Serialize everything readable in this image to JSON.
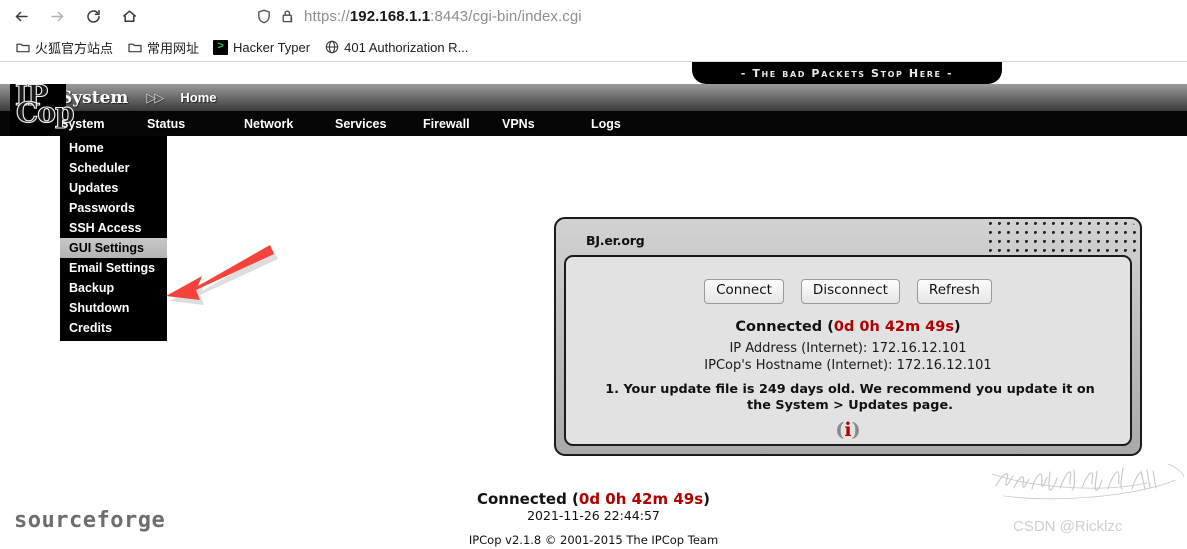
{
  "browser": {
    "back_label": "Back",
    "forward_label": "Forward",
    "reload_label": "Reload",
    "home_label": "Home",
    "shield_icon": "shield-icon",
    "lock_warning_icon": "lock-warning-icon",
    "url_scheme": "https://",
    "url_host": "192.168.1.1",
    "url_rest": ":8443/cgi-bin/index.cgi",
    "url_full": "https://192.168.1.1:8443/cgi-bin/index.cgi",
    "bookmarks": [
      {
        "label": "火狐官方站点",
        "icon": "folder-icon"
      },
      {
        "label": "常用网址",
        "icon": "folder-icon"
      },
      {
        "label": "Hacker Typer",
        "icon": "terminal-icon",
        "glyph": ">"
      },
      {
        "label": "401 Authorization R...",
        "icon": "globe-icon"
      }
    ]
  },
  "banner": {
    "text": "- The bad Packets Stop Here -"
  },
  "logo": {
    "line1": "IP",
    "line2": "Cop",
    "alt": "ipcop-logo"
  },
  "header": {
    "section": "System",
    "separator": "▷▷",
    "breadcrumb": "Home"
  },
  "nav": {
    "items": [
      {
        "label": "System",
        "active": true
      },
      {
        "label": "Status",
        "active": false
      },
      {
        "label": "Network",
        "active": false
      },
      {
        "label": "Services",
        "active": false
      },
      {
        "label": "Firewall",
        "active": false
      },
      {
        "label": "VPNs",
        "active": false
      },
      {
        "label": "Logs",
        "active": false
      }
    ]
  },
  "submenu": {
    "items": [
      {
        "label": "Home",
        "active": false
      },
      {
        "label": "Scheduler",
        "active": false
      },
      {
        "label": "Updates",
        "active": false
      },
      {
        "label": "Passwords",
        "active": false
      },
      {
        "label": "SSH Access",
        "active": false
      },
      {
        "label": "GUI Settings",
        "active": true
      },
      {
        "label": "Email Settings",
        "active": false
      },
      {
        "label": "Backup",
        "active": false
      },
      {
        "label": "Shutdown",
        "active": false
      },
      {
        "label": "Credits",
        "active": false
      }
    ]
  },
  "panel": {
    "title": "BJ.er.org",
    "buttons": [
      {
        "label": "Connect",
        "name": "connect-button"
      },
      {
        "label": "Disconnect",
        "name": "disconnect-button"
      },
      {
        "label": "Refresh",
        "name": "refresh-button"
      }
    ],
    "status_prefix": "Connected (",
    "status_uptime": "0d 0h 42m 49s",
    "status_suffix": ")",
    "ip_address": "IP Address (Internet): 172.16.12.101",
    "hostname": "IPCop's Hostname (Internet): 172.16.12.101",
    "warning": "1. Your update file is 249 days old. We recommend you update it on the System > Updates page.",
    "info_icon": "info-icon",
    "info_glyph": "i"
  },
  "footer": {
    "status_prefix": "Connected (",
    "status_uptime": "0d 0h 42m 49s",
    "status_suffix": ")",
    "timestamp": "2021-11-26 22:44:57",
    "copyright": "IPCop v2.1.8 © 2001-2015 The IPCop Team",
    "sourceforge": "sourceforge"
  },
  "annotation": {
    "arrow_name": "red-pointer-arrow",
    "arrow_color": "#F4433C",
    "scribble_name": "handwriting-watermark"
  },
  "watermark": {
    "text": "CSDN @Ricklzc"
  },
  "colors": {
    "accent_red": "#b00000",
    "arrow_red": "#F4433C",
    "nav_black": "#060606",
    "panel_gray": "#e2e2e2",
    "watermark_gray": "#cfcfcf"
  }
}
